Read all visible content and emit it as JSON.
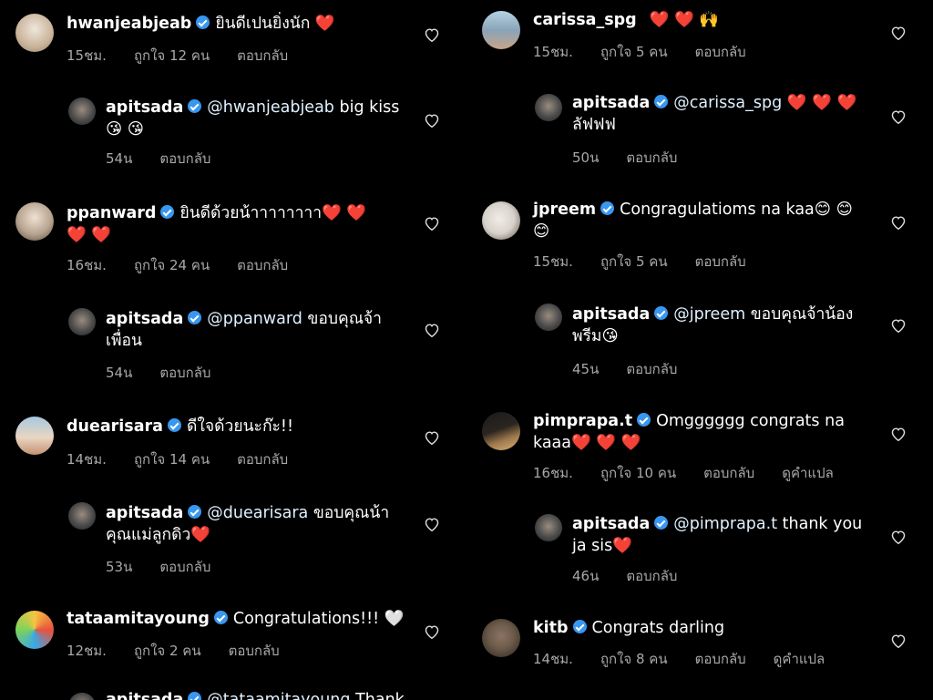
{
  "left": [
    {
      "user": "hwanjeabjeab",
      "text": "ยินดีเปนยิ่งนัก ❤️",
      "time": "15ชม.",
      "likes": "ถูกใจ 12 คน",
      "reply": "ตอบกลับ",
      "avatar_color": "#c9b39a"
    },
    {
      "user": "apitsada",
      "mention": "@hwanjeabjeab",
      "text": " big kiss",
      "text2": "😘 😘",
      "time": "54น",
      "reply": "ตอบกลับ",
      "avatar_color": "#4a4a4a"
    },
    {
      "user": "ppanward",
      "text": "ยินดีด้วยน้าาาาาาาา❤️ ❤️",
      "text2": "❤️ ❤️",
      "time": "16ชม.",
      "likes": "ถูกใจ 24 คน",
      "reply": "ตอบกลับ",
      "avatar_color": "#b7a491"
    },
    {
      "user": "apitsada",
      "mention": "@ppanward",
      "text": " ขอบคุณจ้า",
      "text2": "เพื่อน",
      "time": "54น",
      "reply": "ตอบกลับ",
      "avatar_color": "#4a4a4a"
    },
    {
      "user": "duearisara",
      "text": "ดีใจด้วยนะก๊ะ!!",
      "time": "14ชม.",
      "likes": "ถูกใจ 14 คน",
      "reply": "ตอบกลับ",
      "avatar_color": "#d4a78a"
    },
    {
      "user": "apitsada",
      "mention": "@duearisara",
      "text": " ขอบคุณน้า",
      "text2": "คุณแม่ลูกดิว❤️",
      "time": "53น",
      "reply": "ตอบกลับ",
      "avatar_color": "#4a4a4a"
    },
    {
      "user": "tataamitayoung",
      "text": "Congratulations!!! 🤍",
      "time": "12ชม.",
      "likes": "ถูกใจ 2 คน",
      "reply": "ตอบกลับ",
      "avatar_color": "#e9a13b"
    },
    {
      "user": "apitsada",
      "mention": "@tataamitayoung",
      "text": " Thank",
      "avatar_color": "#4a4a4a"
    }
  ],
  "right": [
    {
      "user": "carissa_spg",
      "text": "❤️ ❤️ 🙌",
      "time": "15ชม.",
      "likes": "ถูกใจ 5 คน",
      "reply": "ตอบกลับ",
      "avatar_color": "#8aa3b8"
    },
    {
      "user": "apitsada",
      "mention": "@carissa_spg",
      "text": " ❤️ ❤️ ❤️",
      "text2": "ลัฟฟฟ",
      "time": "50น",
      "reply": "ตอบกลับ",
      "avatar_color": "#4a4a4a"
    },
    {
      "user": "jpreem",
      "text": "Congragulatioms na kaa😊 😊",
      "text2": "😊",
      "time": "15ชม.",
      "likes": "ถูกใจ 5 คน",
      "reply": "ตอบกลับ",
      "avatar_color": "#d8d2cc"
    },
    {
      "user": "apitsada",
      "mention": "@jpreem",
      "text": " ขอบคุณจ้าน้อง",
      "text2": "พรีม😘",
      "time": "45น",
      "reply": "ตอบกลับ",
      "avatar_color": "#4a4a4a"
    },
    {
      "user": "pimprapa.t",
      "text": "Omgggggg congrats na",
      "text2": "kaaa❤️ ❤️ ❤️",
      "time": "16ชม.",
      "likes": "ถูกใจ 10 คน",
      "reply": "ตอบกลับ",
      "translate": "ดูคำแปล",
      "avatar_color": "#a07a4e"
    },
    {
      "user": "apitsada",
      "mention": "@pimprapa.t",
      "text": " thank you",
      "text2": "ja sis❤️",
      "time": "46น",
      "reply": "ตอบกลับ",
      "avatar_color": "#4a4a4a"
    },
    {
      "user": "kitb",
      "text": "Congrats darling",
      "time": "14ชม.",
      "likes": "ถูกใจ 8 คน",
      "reply": "ตอบกลับ",
      "translate": "ดูคำแปล",
      "avatar_color": "#6b5a4a"
    }
  ]
}
